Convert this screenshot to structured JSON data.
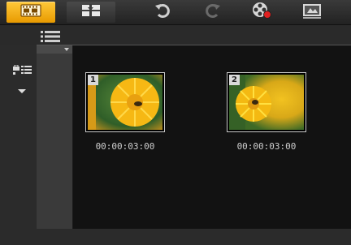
{
  "toolbar": {
    "modes": [
      {
        "icon": "storyboard-icon",
        "active": true
      },
      {
        "icon": "timeline-icon",
        "active": false
      }
    ],
    "tools": [
      {
        "icon": "undo-icon"
      },
      {
        "icon": "redo-icon"
      },
      {
        "icon": "record-capture-icon"
      },
      {
        "icon": "render-icon"
      }
    ]
  },
  "colors": {
    "accent": "#f0a800",
    "library_bg": "#121212",
    "panel_bg": "#2b2b2b"
  },
  "clips": [
    {
      "number": "1",
      "duration": "00:00:03:00"
    },
    {
      "number": "2",
      "duration": "00:00:03:00"
    }
  ]
}
